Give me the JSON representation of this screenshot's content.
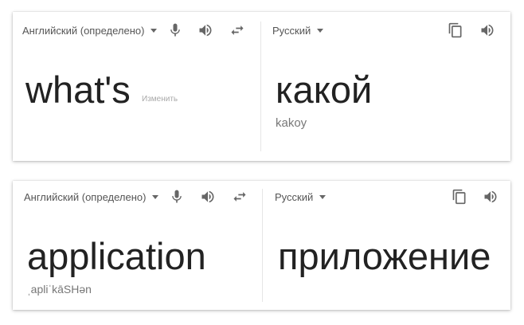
{
  "cards": [
    {
      "source_language": "Английский (определено)",
      "target_language": "Русский",
      "source_text": "what's",
      "edit_label": "Изменить",
      "translation": "какой",
      "transliteration": "kakoy"
    },
    {
      "source_language": "Английский (определено)",
      "target_language": "Русский",
      "source_text": "application",
      "phonetic": "ˌapliˈkāSHən",
      "translation": "приложение"
    }
  ],
  "icons": {
    "mic": "microphone-icon",
    "speaker": "speaker-icon",
    "swap": "swap-icon",
    "copy": "copy-icon"
  },
  "colors": {
    "text_main": "#222222",
    "text_secondary": "#777777",
    "icon": "#666666"
  }
}
